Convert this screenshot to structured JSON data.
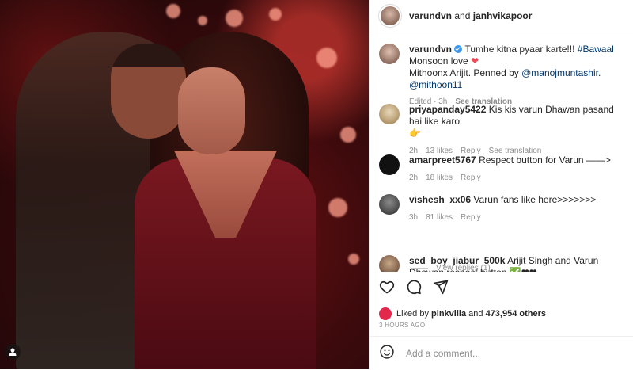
{
  "post": {
    "image_alt": "Couple dancing in a red-lit room",
    "header": {
      "user1": "varundvn",
      "joiner": "and",
      "user2": "janhvikapoor"
    },
    "caption": {
      "username": "varundvn",
      "text_part1": "Tumhe kitna pyaar karte!!!",
      "hashtag": "#Bawaal",
      "line2": "Monsoon love",
      "heart": "❤",
      "line3_prefix": "Mithoonx Arijit. Penned by",
      "mention1": "@manojmuntashir.",
      "mention2": "@mithoon11",
      "edited": "Edited · 3h",
      "see_translation": "See translation"
    },
    "comments": [
      {
        "username": "priyapanday5422",
        "text": "Kis kis varun Dhawan pasand hai like karo",
        "emoji": "👉",
        "time": "2h",
        "likes": "13 likes",
        "reply": "Reply",
        "extra": "See translation",
        "avatar_color": "#b89a6a"
      },
      {
        "username": "amarpreet5767",
        "text": "Respect button for Varun ——>",
        "time": "2h",
        "likes": "18 likes",
        "reply": "Reply",
        "avatar_color": "#111111"
      },
      {
        "username": "vishesh_xx06",
        "text": "Varun fans like here>>>>>>>",
        "time": "3h",
        "likes": "81 likes",
        "reply": "Reply",
        "avatar_color": "#3a3a3a",
        "view_replies": "View replies (1)"
      },
      {
        "username": "sed_boy_jiabur_500k",
        "text": "Arijit Singh and Varun Dhawan respect button",
        "emoji": "✅❤❤",
        "avatar_color": "#8a6a4a"
      }
    ],
    "liked_by_prefix": "Liked by",
    "liked_by_user": "pinkvilla",
    "liked_by_suffix": "and",
    "liked_by_count": "473,954 others",
    "time_ago": "3 HOURS AGO",
    "add_comment_placeholder": "Add a comment...",
    "icons": [
      "like-icon",
      "comment-icon",
      "share-icon",
      "emoji-icon",
      "tagged-user-icon"
    ]
  }
}
